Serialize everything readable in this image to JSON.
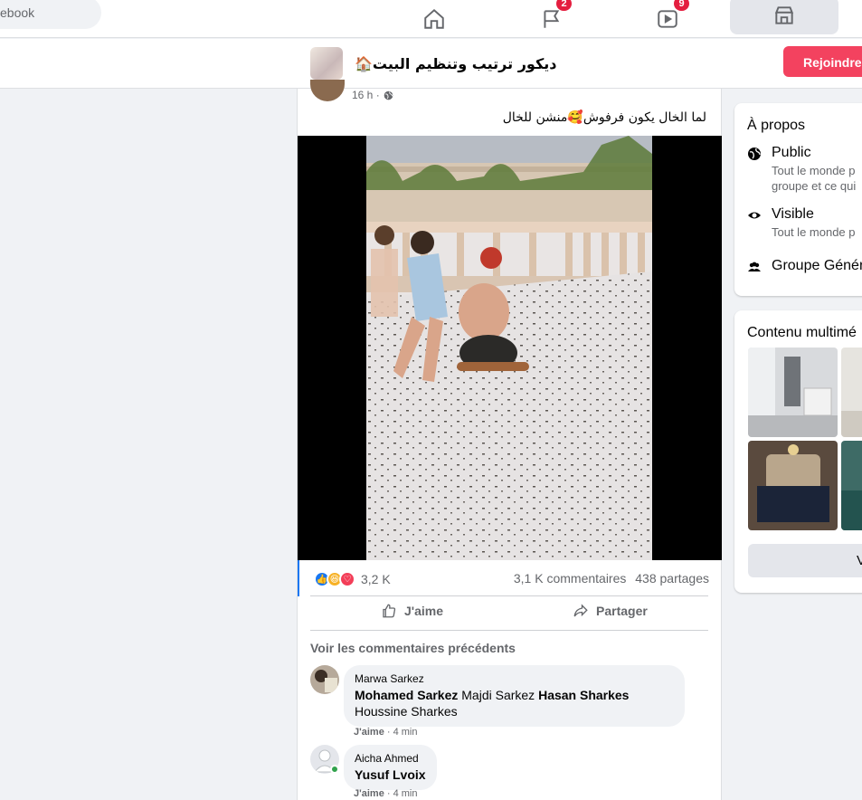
{
  "nav": {
    "search_text": "ebook",
    "flag_badge": "2",
    "watch_badge": "9"
  },
  "group": {
    "name": "ديكور ترتيب وتنظيم البيت🏠",
    "join_label": "Rejoindre"
  },
  "post": {
    "time": "16 h ·",
    "text": "لما الخال يكون فرفوش🥰منشن للخال",
    "reaction_count": "3,2 K",
    "comments_count": "3,1 K commentaires",
    "shares_count": "438 partages",
    "like_label": "J'aime",
    "share_label": "Partager",
    "prev_comments_label": "Voir les commentaires précédents"
  },
  "comments": [
    {
      "author": "Marwa Sarkez",
      "parts": [
        {
          "t": "Mohamed Sarkez",
          "bold": true
        },
        {
          "t": " Majdi Sarkez ",
          "bold": false
        },
        {
          "t": "Hasan Sharkes",
          "bold": true
        },
        {
          "t": " Houssine Sharkes",
          "bold": false
        }
      ],
      "like_label": "J'aime",
      "time": "· 4 min"
    },
    {
      "author": "Aicha Ahmed",
      "parts": [
        {
          "t": "Yusuf Lvoix",
          "bold": true
        }
      ],
      "like_label": "J'aime",
      "time": "· 4 min"
    }
  ],
  "about": {
    "title": "À propos",
    "public_title": "Public",
    "public_desc_1": "Tout le monde p",
    "public_desc_2": "groupe et ce qui",
    "visible_title": "Visible",
    "visible_desc": "Tout le monde p",
    "general_title": "Groupe Génér"
  },
  "media": {
    "title": "Contenu multimé",
    "button_label": "V"
  },
  "colors": {
    "join_button": "#f3425f",
    "badge": "#e41e3f",
    "like_blue": "#1877f2"
  }
}
